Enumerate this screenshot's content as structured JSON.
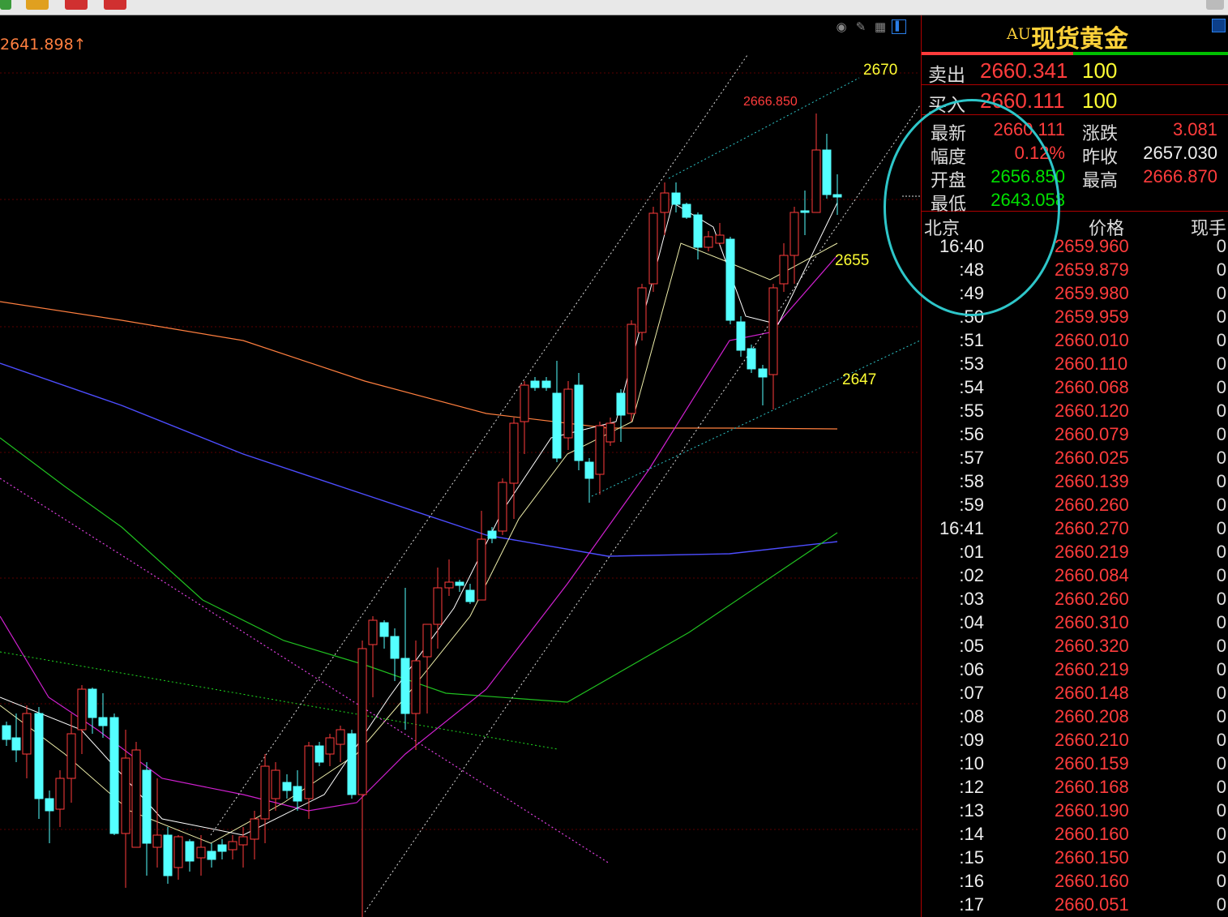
{
  "chart": {
    "top_price_label": "2641.898↑",
    "levels": [
      {
        "label": "2670"
      },
      {
        "label": "2655"
      },
      {
        "label": "2647"
      }
    ],
    "high_label": "2666.850"
  },
  "toolbar_icons": [
    "eye-icon",
    "pencil-icon",
    "grid-icon",
    "panel-toggle-icon"
  ],
  "panel": {
    "code": "AU",
    "name": "现货黄金",
    "sell": {
      "label": "卖出",
      "price": "2660.341",
      "volume": "100"
    },
    "buy": {
      "label": "买入",
      "price": "2660.111",
      "volume": "100"
    },
    "quote": {
      "latest_label": "最新",
      "latest": "2660.111",
      "change_label": "涨跌",
      "change": "3.081",
      "amplitude_label": "幅度",
      "amplitude": "0.12%",
      "prev_close_label": "昨收",
      "prev_close": "2657.030",
      "open_label": "开盘",
      "open": "2656.850",
      "high_label": "最高",
      "high": "2666.870",
      "low_label": "最低",
      "low": "2643.058"
    },
    "tick_header": {
      "time": "北京",
      "price": "价格",
      "volume": "现手"
    },
    "ticks": [
      {
        "t": "16:40",
        "p": "2659.960",
        "v": "0"
      },
      {
        "t": ":48",
        "p": "2659.879",
        "v": "0"
      },
      {
        "t": ":49",
        "p": "2659.980",
        "v": "0"
      },
      {
        "t": ":50",
        "p": "2659.959",
        "v": "0"
      },
      {
        "t": ":51",
        "p": "2660.010",
        "v": "0"
      },
      {
        "t": ":53",
        "p": "2660.110",
        "v": "0"
      },
      {
        "t": ":54",
        "p": "2660.068",
        "v": "0"
      },
      {
        "t": ":55",
        "p": "2660.120",
        "v": "0"
      },
      {
        "t": ":56",
        "p": "2660.079",
        "v": "0"
      },
      {
        "t": ":57",
        "p": "2660.025",
        "v": "0"
      },
      {
        "t": ":58",
        "p": "2660.139",
        "v": "0"
      },
      {
        "t": ":59",
        "p": "2660.260",
        "v": "0"
      },
      {
        "t": "16:41",
        "p": "2660.270",
        "v": "0"
      },
      {
        "t": ":01",
        "p": "2660.219",
        "v": "0"
      },
      {
        "t": ":02",
        "p": "2660.084",
        "v": "0"
      },
      {
        "t": ":03",
        "p": "2660.260",
        "v": "0"
      },
      {
        "t": ":04",
        "p": "2660.310",
        "v": "0"
      },
      {
        "t": ":05",
        "p": "2660.320",
        "v": "0"
      },
      {
        "t": ":06",
        "p": "2660.219",
        "v": "0"
      },
      {
        "t": ":07",
        "p": "2660.148",
        "v": "0"
      },
      {
        "t": ":08",
        "p": "2660.208",
        "v": "0"
      },
      {
        "t": ":09",
        "p": "2660.210",
        "v": "0"
      },
      {
        "t": ":10",
        "p": "2660.159",
        "v": "0"
      },
      {
        "t": ":12",
        "p": "2660.168",
        "v": "0"
      },
      {
        "t": ":13",
        "p": "2660.190",
        "v": "0"
      },
      {
        "t": ":14",
        "p": "2660.160",
        "v": "0"
      },
      {
        "t": ":15",
        "p": "2660.150",
        "v": "0"
      },
      {
        "t": ":16",
        "p": "2660.160",
        "v": "0"
      },
      {
        "t": ":17",
        "p": "2660.051",
        "v": "0"
      }
    ]
  },
  "colors": {
    "up": "#ff3c3c",
    "down": "#54ffff",
    "accent": "#ffd23a",
    "annotation": "#2ec6c9"
  }
}
